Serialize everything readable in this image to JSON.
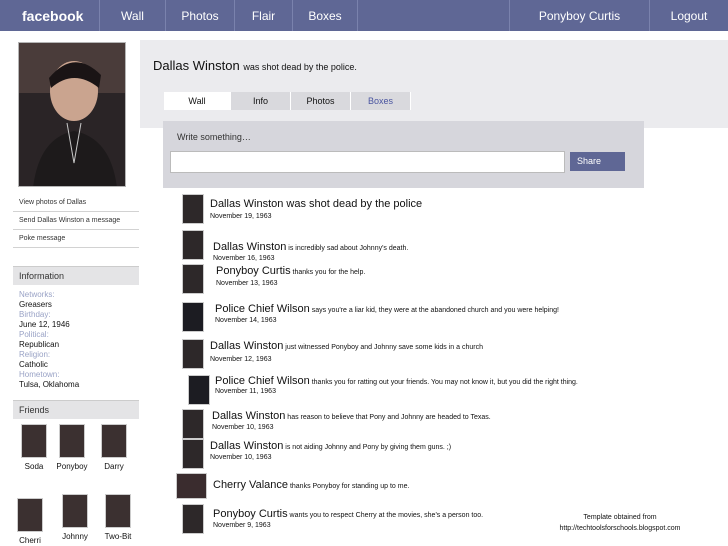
{
  "nav": {
    "logo": "facebook",
    "items": [
      "Wall",
      "Photos",
      "Flair",
      "Boxes"
    ],
    "user": "Ponyboy Curtis",
    "logout": "Logout"
  },
  "profile": {
    "name": "Dallas Winston",
    "status": "was shot dead by the police."
  },
  "left_links": [
    "View photos of Dallas",
    "Send Dallas Winston a message",
    "Poke message"
  ],
  "information": {
    "heading": "Information",
    "fields": [
      {
        "key": "Networks:",
        "value": "Greasers"
      },
      {
        "key": "Birthday:",
        "value": "June 12, 1946"
      },
      {
        "key": "Political:",
        "value": "Republican"
      },
      {
        "key": "Religion:",
        "value": "Catholic"
      },
      {
        "key": "Hometown:",
        "value": "Tulsa, Oklahoma"
      }
    ]
  },
  "friends": {
    "heading": "Friends",
    "list": [
      "Soda",
      "Ponyboy",
      "Darry",
      "Cherri",
      "Johnny",
      "Two-Bit"
    ]
  },
  "tabs": [
    "Wall",
    "Info",
    "Photos",
    "Boxes"
  ],
  "composer": {
    "prompt": "Write something…",
    "share": "Share"
  },
  "feed": [
    {
      "who": "Dallas Winston",
      "text": " was shot dead by the police",
      "date": "November 19, 1963"
    },
    {
      "who": "Dallas Winston",
      "text": " is incredibly sad about Johnny's death.",
      "date": "November 16, 1963"
    },
    {
      "who": "Ponyboy Curtis",
      "text": " thanks you for the help.",
      "date": "November 13, 1963"
    },
    {
      "who": "Police Chief Wilson",
      "text": " says you're a liar kid, they were at the abandoned church and you were helping!",
      "date": "November 14, 1963"
    },
    {
      "who": "Dallas Winston",
      "text": " just witnessed Ponyboy and Johnny save some kids in a church",
      "date": "November 12, 1963"
    },
    {
      "who": "Police Chief Wilson",
      "text": " thanks you for ratting out your friends. You may not know it, but you did the right thing.",
      "date": "November 11, 1963"
    },
    {
      "who": "Dallas Winston",
      "text": " has reason to believe that Pony and Johnny are headed to Texas.",
      "date": "November 10, 1963"
    },
    {
      "who": "Dallas Winston",
      "text": " is not aiding Johnny and Pony by giving them guns. ;)",
      "date": "November 10, 1963"
    },
    {
      "who": "Cherry Valance",
      "text": " thanks Ponyboy for standing up to me.",
      "date": ""
    },
    {
      "who": "Ponyboy Curtis",
      "text": " wants you to respect  Cherry at the movies, she's a person too.",
      "date": "November 9, 1963"
    }
  ],
  "credit": {
    "line1": "Template obtained from",
    "line2": "http://techtoolsforschools.blogspot.com"
  }
}
